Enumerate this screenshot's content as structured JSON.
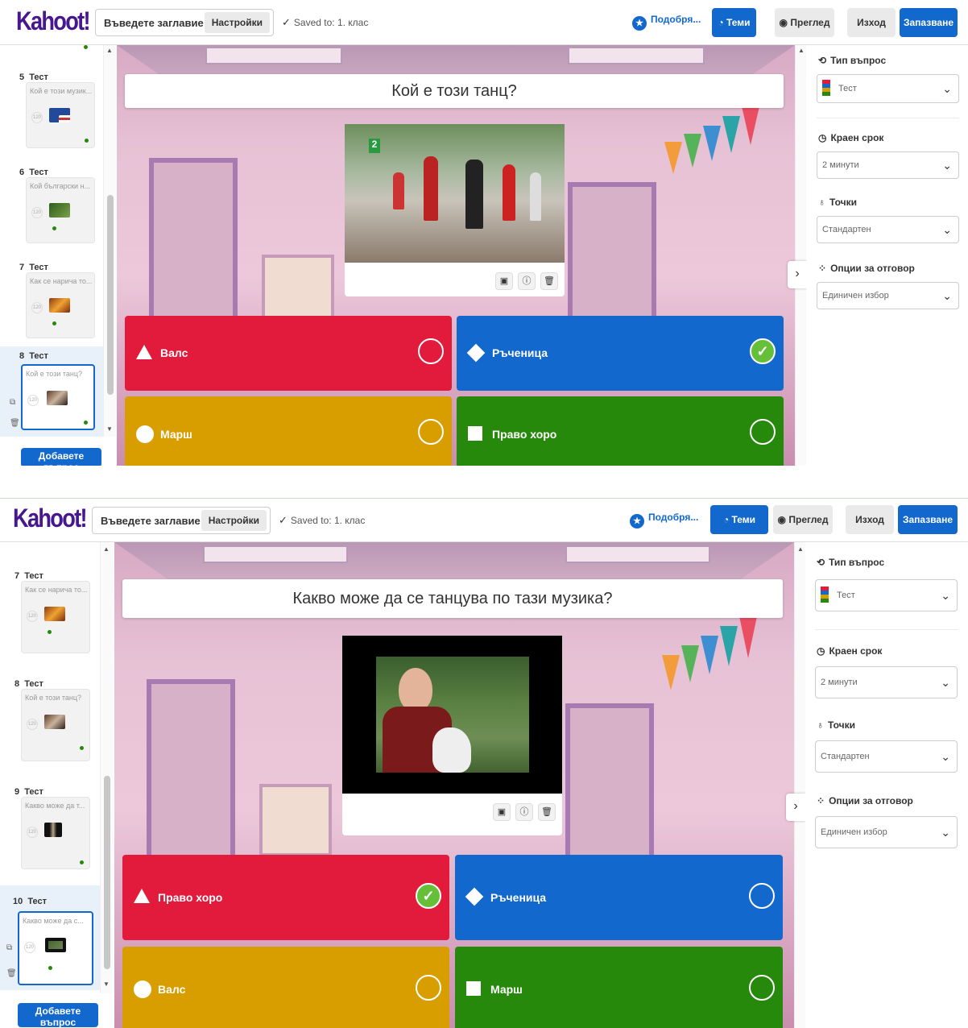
{
  "screens": [
    {
      "header": {
        "logo": "Kahoot!",
        "title_placeholder": "Въведете заглавие ...",
        "settings_label": "Настройки",
        "saved_text": "Saved to: 1. клас",
        "improve_label": "Подобря...",
        "themes_label": "Теми",
        "preview_label": "Преглед",
        "exit_label": "Изход",
        "save_label": "Запазване"
      },
      "sidebar": {
        "items": [
          {
            "num": "5",
            "type": "Тест",
            "question": "Кой е този музик..."
          },
          {
            "num": "6",
            "type": "Тест",
            "question": "Кой български н..."
          },
          {
            "num": "7",
            "type": "Тест",
            "question": "Как се нарича то..."
          },
          {
            "num": "8",
            "type": "Тест",
            "question": "Кой е този танц?"
          }
        ],
        "add_label": "Добавете въпрос"
      },
      "question": "Кой е този танц?",
      "answers": [
        {
          "text": "Валс",
          "correct": false,
          "color": "#e21b3c",
          "shape": "triangle"
        },
        {
          "text": "Ръченица",
          "correct": true,
          "color": "#1368ce",
          "shape": "diamond"
        },
        {
          "text": "Марш",
          "correct": false,
          "color": "#d89e00",
          "shape": "circle"
        },
        {
          "text": "Право хоро",
          "correct": false,
          "color": "#26890c",
          "shape": "square"
        }
      ],
      "settings": {
        "question_type_label": "Тип въпрос",
        "question_type_value": "Тест",
        "time_limit_label": "Краен срок",
        "time_limit_value": "2 минути",
        "points_label": "Точки",
        "points_value": "Стандартен",
        "answer_options_label": "Опции за отговор",
        "answer_options_value": "Единичен избор"
      }
    },
    {
      "header": {
        "logo": "Kahoot!",
        "title_placeholder": "Въведете заглавие ...",
        "settings_label": "Настройки",
        "saved_text": "Saved to: 1. клас",
        "improve_label": "Подобря...",
        "themes_label": "Теми",
        "preview_label": "Преглед",
        "exit_label": "Изход",
        "save_label": "Запазване"
      },
      "sidebar": {
        "items": [
          {
            "num": "7",
            "type": "Тест",
            "question": "Как се нарича то..."
          },
          {
            "num": "8",
            "type": "Тест",
            "question": "Кой е този танц?"
          },
          {
            "num": "9",
            "type": "Тест",
            "question": "Какво може да т..."
          },
          {
            "num": "10",
            "type": "Тест",
            "question": "Какво може да с..."
          }
        ],
        "add_label": "Добавете въпрос"
      },
      "question": "Какво може да се танцува по тази музика?",
      "answers": [
        {
          "text": "Право хоро",
          "correct": true,
          "color": "#e21b3c",
          "shape": "triangle"
        },
        {
          "text": "Ръченица",
          "correct": false,
          "color": "#1368ce",
          "shape": "diamond"
        },
        {
          "text": "Валс",
          "correct": false,
          "color": "#d89e00",
          "shape": "circle"
        },
        {
          "text": "Марш",
          "correct": false,
          "color": "#26890c",
          "shape": "square"
        }
      ],
      "settings": {
        "question_type_label": "Тип въпрос",
        "question_type_value": "Тест",
        "time_limit_label": "Краен срок",
        "time_limit_value": "2 минути",
        "points_label": "Точки",
        "points_value": "Стандартен",
        "answer_options_label": "Опции за отговор",
        "answer_options_value": "Единичен избор"
      }
    }
  ]
}
